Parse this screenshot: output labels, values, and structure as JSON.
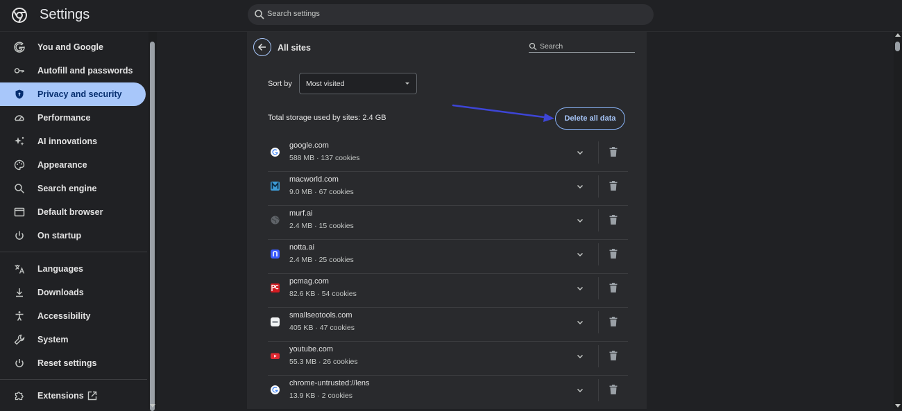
{
  "header": {
    "title": "Settings",
    "search_placeholder": "Search settings",
    "logo_icon": "chrome-logo-icon"
  },
  "sidebar": {
    "items": [
      {
        "label": "You and Google",
        "icon": "google-icon"
      },
      {
        "label": "Autofill and passwords",
        "icon": "key-icon"
      },
      {
        "label": "Privacy and security",
        "icon": "shield-icon",
        "active": true
      },
      {
        "label": "Performance",
        "icon": "speedometer-icon"
      },
      {
        "label": "AI innovations",
        "icon": "sparkle-icon"
      },
      {
        "label": "Appearance",
        "icon": "palette-icon"
      },
      {
        "label": "Search engine",
        "icon": "search-icon"
      },
      {
        "label": "Default browser",
        "icon": "browser-window-icon"
      },
      {
        "label": "On startup",
        "icon": "power-icon"
      },
      {
        "label": "Languages",
        "icon": "translate-icon"
      },
      {
        "label": "Downloads",
        "icon": "download-icon"
      },
      {
        "label": "Accessibility",
        "icon": "accessibility-icon"
      },
      {
        "label": "System",
        "icon": "wrench-icon"
      },
      {
        "label": "Reset settings",
        "icon": "reset-icon"
      },
      {
        "label": "Extensions",
        "icon": "puzzle-icon"
      }
    ],
    "active_color": "#a8c7fa"
  },
  "main": {
    "title": "All sites",
    "search_placeholder": "Search",
    "sort_label": "Sort by",
    "sort_value": "Most visited",
    "storage_text": "Total storage used by sites: 2.4 GB",
    "delete_all_label": "Delete all data",
    "sites": [
      {
        "name": "google.com",
        "meta": "588 MB · 137 cookies",
        "favicon": "google-favicon"
      },
      {
        "name": "macworld.com",
        "meta": "9.0 MB · 67 cookies",
        "favicon": "macworld-favicon"
      },
      {
        "name": "murf.ai",
        "meta": "2.4 MB · 15 cookies",
        "favicon": "globe-favicon"
      },
      {
        "name": "notta.ai",
        "meta": "2.4 MB · 25 cookies",
        "favicon": "notta-favicon"
      },
      {
        "name": "pcmag.com",
        "meta": "82.6 KB · 54 cookies",
        "favicon": "pcmag-favicon"
      },
      {
        "name": "smallseotools.com",
        "meta": "405 KB · 47 cookies",
        "favicon": "smallseotools-favicon"
      },
      {
        "name": "youtube.com",
        "meta": "55.3 MB · 26 cookies",
        "favicon": "youtube-favicon"
      },
      {
        "name": "chrome-untrusted://lens",
        "meta": "13.9 KB · 2 cookies",
        "favicon": "google-favicon"
      }
    ]
  },
  "colors": {
    "background": "#202124",
    "panel": "#292a2d",
    "accent": "#a8c7fa",
    "annotation_arrow": "#3d45d6"
  }
}
